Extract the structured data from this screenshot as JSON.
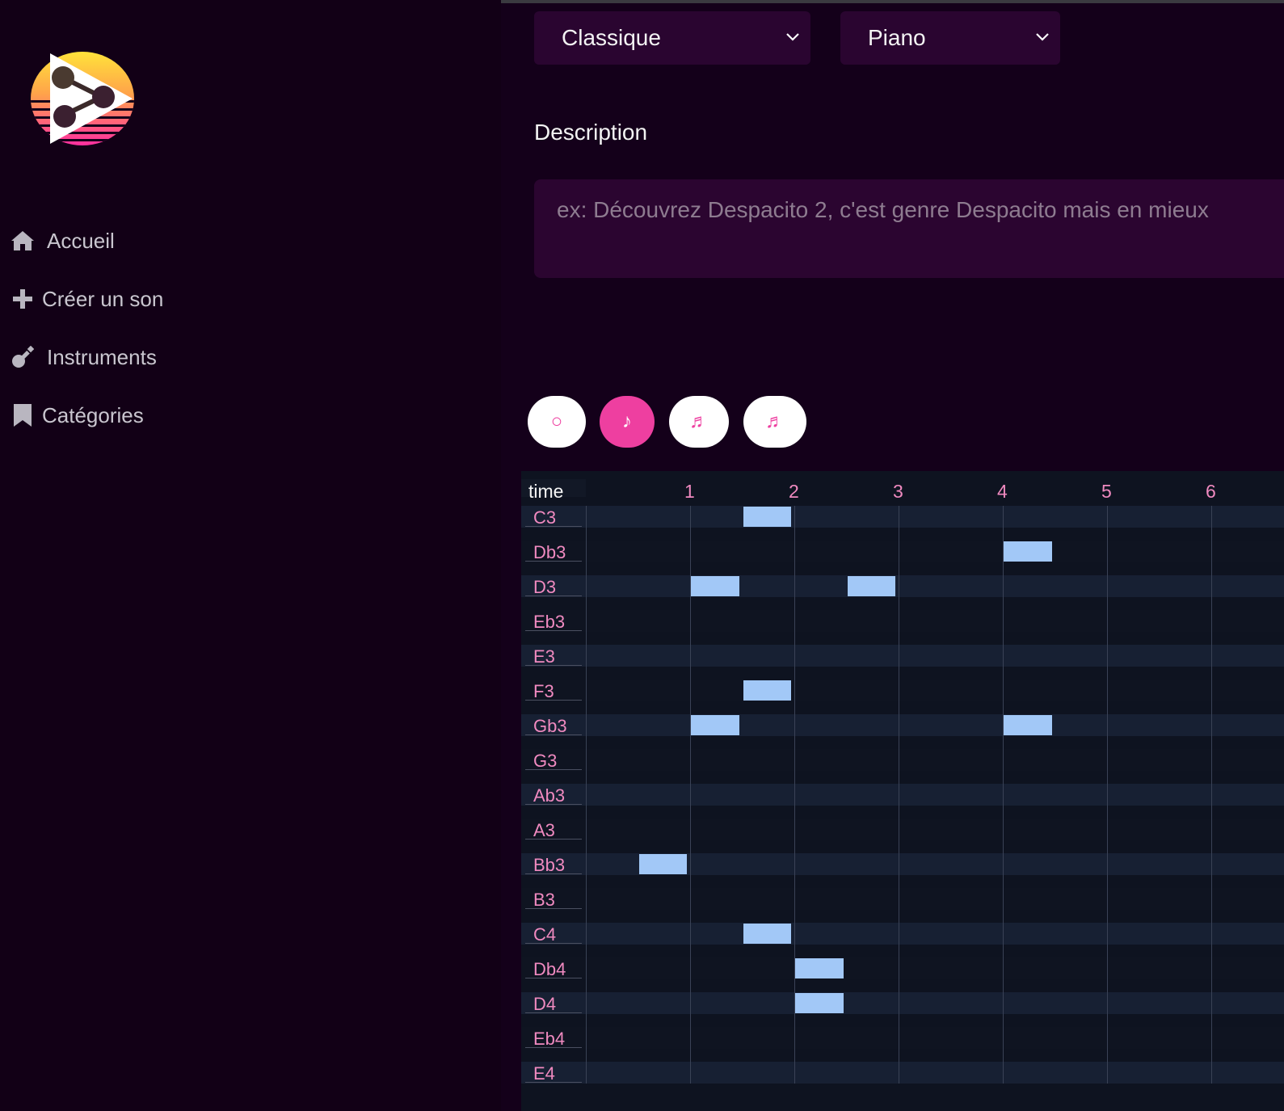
{
  "sidebar": {
    "nav": [
      {
        "label": "Accueil",
        "icon": "home-icon"
      },
      {
        "label": "Créer un son",
        "icon": "plus-icon"
      },
      {
        "label": "Instruments",
        "icon": "guitar-icon"
      },
      {
        "label": "Catégories",
        "icon": "bookmark-icon"
      }
    ]
  },
  "form": {
    "category_select": {
      "value": "Classique"
    },
    "instrument_select": {
      "value": "Piano"
    },
    "description_label": "Description",
    "description_placeholder": "ex: Découvrez Despacito 2, c'est genre Despacito mais en mieux"
  },
  "note_buttons": [
    {
      "glyph": "○",
      "name": "whole-note-button",
      "active": false
    },
    {
      "glyph": "♪",
      "name": "eighth-note-button",
      "active": true
    },
    {
      "glyph": "♬",
      "name": "beamed-sixteenth-button",
      "active": false
    },
    {
      "glyph": "♬",
      "name": "beamed-notes-button",
      "active": false
    }
  ],
  "sequencer": {
    "time_label": "time",
    "beats": [
      "1",
      "2",
      "3",
      "4",
      "5",
      "6"
    ],
    "rows": [
      "C3",
      "Db3",
      "D3",
      "Eb3",
      "E3",
      "F3",
      "Gb3",
      "G3",
      "Ab3",
      "A3",
      "Bb3",
      "B3",
      "C4",
      "Db4",
      "D4",
      "Eb4",
      "E4"
    ],
    "notes": [
      {
        "pitch": "C3",
        "start": 1.5,
        "duration": 0.5
      },
      {
        "pitch": "Db3",
        "start": 4,
        "duration": 0.5
      },
      {
        "pitch": "D3",
        "start": 1,
        "duration": 0.5
      },
      {
        "pitch": "D3",
        "start": 2.5,
        "duration": 0.5
      },
      {
        "pitch": "F3",
        "start": 1.5,
        "duration": 0.5
      },
      {
        "pitch": "Gb3",
        "start": 1,
        "duration": 0.5
      },
      {
        "pitch": "Gb3",
        "start": 4,
        "duration": 0.5
      },
      {
        "pitch": "Bb3",
        "start": 0.5,
        "duration": 0.5
      },
      {
        "pitch": "C4",
        "start": 1.5,
        "duration": 0.5
      },
      {
        "pitch": "Db4",
        "start": 2,
        "duration": 0.5
      },
      {
        "pitch": "D4",
        "start": 2,
        "duration": 0.5
      }
    ]
  },
  "colors": {
    "accent": "#ee3fa0",
    "note_block": "#a2c8f7",
    "background": "#14001a",
    "field": "#2a0530"
  }
}
